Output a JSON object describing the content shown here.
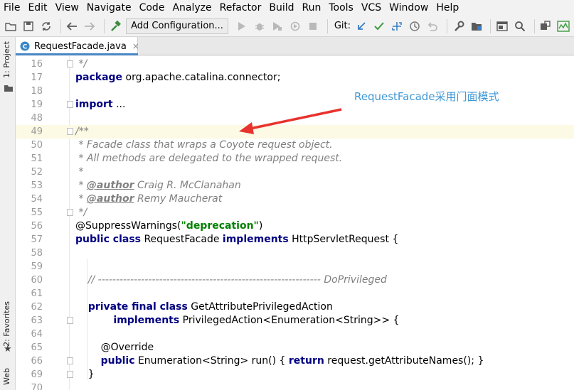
{
  "menu": {
    "items": [
      "File",
      "Edit",
      "View",
      "Navigate",
      "Code",
      "Analyze",
      "Refactor",
      "Build",
      "Run",
      "Tools",
      "VCS",
      "Window",
      "Help"
    ]
  },
  "toolbar": {
    "run_config_label": "Add Configuration...",
    "git_label": "Git:"
  },
  "side_tabs": {
    "project": "1: Project",
    "favorites": "2: Favorites",
    "web": "Web"
  },
  "editor_tab": {
    "filename": "RequestFacade.java",
    "close": "×"
  },
  "annotation": {
    "text": "RequestFacade采用门面模式",
    "color": "#3e97d6"
  },
  "code_lines": [
    {
      "n": "16",
      "segments": [
        [
          "cm",
          " */"
        ]
      ]
    },
    {
      "n": "17",
      "segments": [
        [
          "kw",
          "package"
        ],
        [
          "",
          " org.apache.catalina.connector;"
        ]
      ]
    },
    {
      "n": "18",
      "segments": []
    },
    {
      "n": "19",
      "segments": [
        [
          "kw",
          "import"
        ],
        [
          "",
          " ..."
        ]
      ]
    },
    {
      "n": "48",
      "segments": []
    },
    {
      "n": "49",
      "segments": [
        [
          "cm",
          "/**"
        ]
      ]
    },
    {
      "n": "50",
      "segments": [
        [
          "cm",
          " * Facade class that wraps a Coyote request object."
        ]
      ]
    },
    {
      "n": "51",
      "segments": [
        [
          "cm",
          " * All methods are delegated to the wrapped request."
        ]
      ]
    },
    {
      "n": "52",
      "segments": [
        [
          "cm",
          " *"
        ]
      ]
    },
    {
      "n": "53",
      "segments": [
        [
          "cm",
          " * "
        ],
        [
          "tag",
          "@author"
        ],
        [
          "cm",
          " Craig R. McClanahan"
        ]
      ]
    },
    {
      "n": "54",
      "segments": [
        [
          "cm",
          " * "
        ],
        [
          "tag",
          "@author"
        ],
        [
          "cm",
          " Remy Maucherat"
        ]
      ]
    },
    {
      "n": "55",
      "segments": [
        [
          "cm",
          " */"
        ]
      ]
    },
    {
      "n": "56",
      "segments": [
        [
          "anno",
          "@SuppressWarnings("
        ],
        [
          "str",
          "\"deprecation\""
        ],
        [
          "anno",
          ")"
        ]
      ]
    },
    {
      "n": "57",
      "segments": [
        [
          "kw",
          "public class"
        ],
        [
          "",
          " RequestFacade "
        ],
        [
          "kw",
          "implements"
        ],
        [
          "",
          " HttpServletRequest {"
        ]
      ]
    },
    {
      "n": "58",
      "segments": []
    },
    {
      "n": "59",
      "segments": []
    },
    {
      "n": "60",
      "segments": [
        [
          "cm",
          "    // -------------------------------------------------------------- DoPrivileged"
        ]
      ]
    },
    {
      "n": "61",
      "segments": []
    },
    {
      "n": "62",
      "segments": [
        [
          "",
          "    "
        ],
        [
          "kw",
          "private final class"
        ],
        [
          "",
          " GetAttributePrivilegedAction"
        ]
      ]
    },
    {
      "n": "63",
      "segments": [
        [
          "",
          "            "
        ],
        [
          "kw",
          "implements"
        ],
        [
          "",
          " PrivilegedAction<Enumeration<String>> {"
        ]
      ]
    },
    {
      "n": "64",
      "segments": []
    },
    {
      "n": "65",
      "segments": [
        [
          "",
          "        @Override"
        ]
      ]
    },
    {
      "n": "66",
      "segments": [
        [
          "",
          "        "
        ],
        [
          "kw",
          "public"
        ],
        [
          "",
          " Enumeration<String> run() { "
        ],
        [
          "kw",
          "return"
        ],
        [
          "",
          " request.getAttributeNames(); }"
        ]
      ]
    },
    {
      "n": "69",
      "segments": [
        [
          "",
          "    }"
        ]
      ]
    },
    {
      "n": "70",
      "segments": []
    }
  ],
  "colors": {
    "keyword": "#000080",
    "comment": "#808080",
    "string": "#008000",
    "highlight_line": "#fcfae4",
    "arrow": "#e8322d"
  }
}
